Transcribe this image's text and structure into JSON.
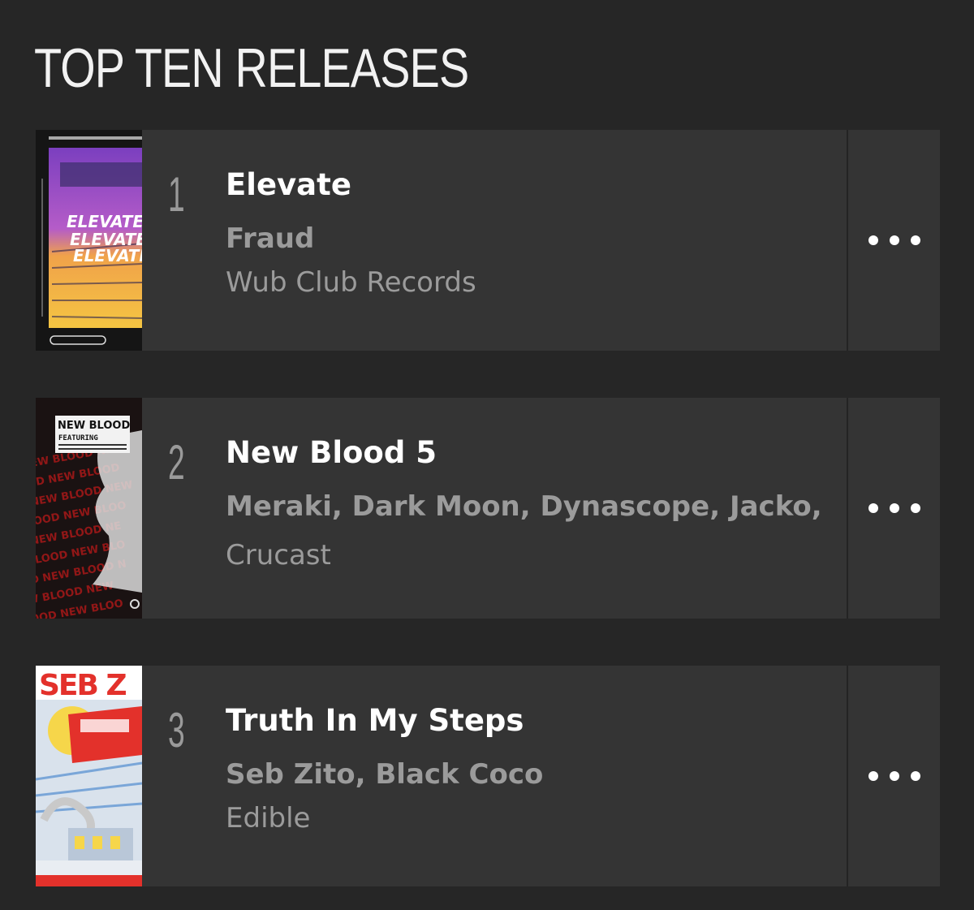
{
  "section": {
    "title": "TOP TEN RELEASES"
  },
  "releases": [
    {
      "rank": "1",
      "title": "Elevate",
      "artists": "Fraud",
      "label": "Wub Club Records",
      "cover_text": "ELEVATE"
    },
    {
      "rank": "2",
      "title": "New Blood 5",
      "artists_line1": "Meraki, Dark Moon, Dynascope, Jacko,",
      "artists_line2": "Crucast",
      "cover_text": "NEW BLOOD",
      "cover_subtext": "FEATURING"
    },
    {
      "rank": "3",
      "title": "Truth In My Steps",
      "artists": "Seb Zito, Black Coco",
      "label": "Edible",
      "cover_text": "SEB Z"
    }
  ],
  "colors": {
    "background": "#262626",
    "card": "#343434",
    "title_text": "#ffffff",
    "secondary_text": "#9b9b9b"
  },
  "icons": {
    "more": "more-horizontal-icon"
  }
}
